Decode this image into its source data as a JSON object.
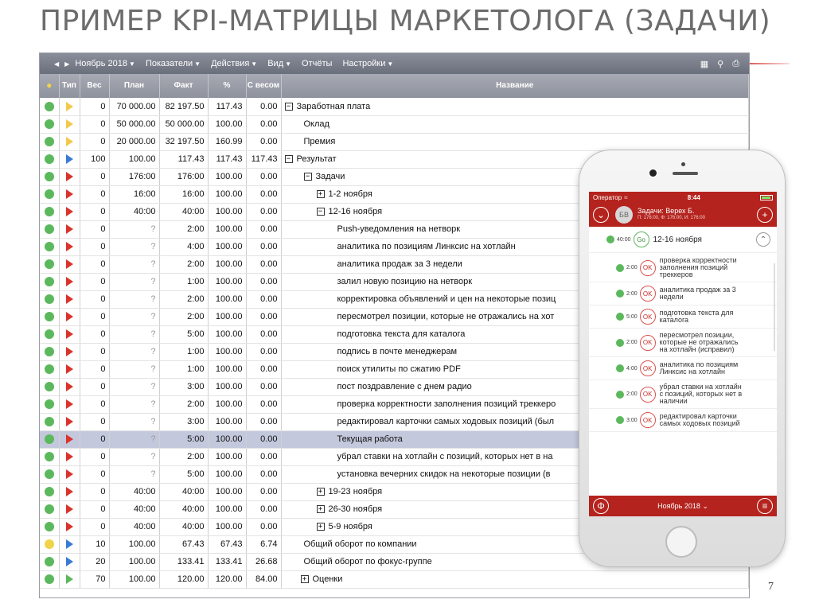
{
  "slide": {
    "title": "ПРИМЕР KPI-МАТРИЦЫ МАРКЕТОЛОГА (ЗАДАЧИ)",
    "page_number": "7"
  },
  "toolbar": {
    "prev_icon": "caret-left-icon",
    "next_icon": "caret-right-icon",
    "menus": [
      "Ноябрь 2018",
      "Показатели",
      "Действия",
      "Вид",
      "Отчёты",
      "Настройки"
    ],
    "right_icons": [
      "grid-icon",
      "search-icon",
      "print-icon"
    ]
  },
  "colors": {
    "status_green": "#5cb85c",
    "status_yellow": "#f0d34a",
    "flag_yellow": "#f2c94c",
    "flag_blue": "#3a7bd5",
    "flag_red": "#d9342b",
    "flag_green": "#5cb85c",
    "accent_red": "#b4231d"
  },
  "table": {
    "headers": [
      "",
      "Тип",
      "Вес",
      "План",
      "Факт",
      "%",
      "С весом",
      "Название"
    ],
    "rows": [
      {
        "status": "green",
        "flag": "yellow",
        "ves": "0",
        "plan": "70 000.00",
        "fact": "82 197.50",
        "pct": "117.43",
        "weighted": "0.00",
        "level": 0,
        "toggle": "−",
        "name": "Заработная плата"
      },
      {
        "status": "green",
        "flag": "yellow",
        "ves": "0",
        "plan": "50 000.00",
        "fact": "50 000.00",
        "pct": "100.00",
        "weighted": "0.00",
        "level": 1,
        "toggle": "",
        "name": "Оклад"
      },
      {
        "status": "green",
        "flag": "yellow",
        "ves": "0",
        "plan": "20 000.00",
        "fact": "32 197.50",
        "pct": "160.99",
        "weighted": "0.00",
        "level": 1,
        "toggle": "",
        "name": "Премия"
      },
      {
        "status": "green",
        "flag": "blue",
        "ves": "100",
        "plan": "100.00",
        "fact": "117.43",
        "pct": "117.43",
        "weighted": "117.43",
        "level": 0,
        "toggle": "−",
        "name": "Результат"
      },
      {
        "status": "green",
        "flag": "red",
        "ves": "0",
        "plan": "176:00",
        "fact": "176:00",
        "pct": "100.00",
        "weighted": "0.00",
        "level": 1,
        "toggle": "−",
        "name": "Задачи"
      },
      {
        "status": "green",
        "flag": "red",
        "ves": "0",
        "plan": "16:00",
        "fact": "16:00",
        "pct": "100.00",
        "weighted": "0.00",
        "level": 2,
        "toggle": "+",
        "name": "1-2 ноября"
      },
      {
        "status": "green",
        "flag": "red",
        "ves": "0",
        "plan": "40:00",
        "fact": "40:00",
        "pct": "100.00",
        "weighted": "0.00",
        "level": 2,
        "toggle": "−",
        "name": "12-16 ноября"
      },
      {
        "status": "green",
        "flag": "red",
        "ves": "0",
        "plan": "?",
        "fact": "2:00",
        "pct": "100.00",
        "weighted": "0.00",
        "level": 3,
        "toggle": "",
        "name": "Push-уведомления на нетворк"
      },
      {
        "status": "green",
        "flag": "red",
        "ves": "0",
        "plan": "?",
        "fact": "4:00",
        "pct": "100.00",
        "weighted": "0.00",
        "level": 3,
        "toggle": "",
        "name": "аналитика по позициям Линксис на хотлайн"
      },
      {
        "status": "green",
        "flag": "red",
        "ves": "0",
        "plan": "?",
        "fact": "2:00",
        "pct": "100.00",
        "weighted": "0.00",
        "level": 3,
        "toggle": "",
        "name": "аналитика продаж за 3 недели"
      },
      {
        "status": "green",
        "flag": "red",
        "ves": "0",
        "plan": "?",
        "fact": "1:00",
        "pct": "100.00",
        "weighted": "0.00",
        "level": 3,
        "toggle": "",
        "name": "залил новую позицию на нетворк"
      },
      {
        "status": "green",
        "flag": "red",
        "ves": "0",
        "plan": "?",
        "fact": "2:00",
        "pct": "100.00",
        "weighted": "0.00",
        "level": 3,
        "toggle": "",
        "name": "корректировка объявлений и цен на некоторые позиц"
      },
      {
        "status": "green",
        "flag": "red",
        "ves": "0",
        "plan": "?",
        "fact": "2:00",
        "pct": "100.00",
        "weighted": "0.00",
        "level": 3,
        "toggle": "",
        "name": "пересмотрел позиции, которые не отражались на хот"
      },
      {
        "status": "green",
        "flag": "red",
        "ves": "0",
        "plan": "?",
        "fact": "5:00",
        "pct": "100.00",
        "weighted": "0.00",
        "level": 3,
        "toggle": "",
        "name": "подготовка текста для каталога"
      },
      {
        "status": "green",
        "flag": "red",
        "ves": "0",
        "plan": "?",
        "fact": "1:00",
        "pct": "100.00",
        "weighted": "0.00",
        "level": 3,
        "toggle": "",
        "name": "подпись в почте менеджерам"
      },
      {
        "status": "green",
        "flag": "red",
        "ves": "0",
        "plan": "?",
        "fact": "1:00",
        "pct": "100.00",
        "weighted": "0.00",
        "level": 3,
        "toggle": "",
        "name": "поиск утилиты по сжатию PDF"
      },
      {
        "status": "green",
        "flag": "red",
        "ves": "0",
        "plan": "?",
        "fact": "3:00",
        "pct": "100.00",
        "weighted": "0.00",
        "level": 3,
        "toggle": "",
        "name": "пост поздравление с днем радио"
      },
      {
        "status": "green",
        "flag": "red",
        "ves": "0",
        "plan": "?",
        "fact": "2:00",
        "pct": "100.00",
        "weighted": "0.00",
        "level": 3,
        "toggle": "",
        "name": "проверка корректности заполнения позиций треккеро"
      },
      {
        "status": "green",
        "flag": "red",
        "ves": "0",
        "plan": "?",
        "fact": "3:00",
        "pct": "100.00",
        "weighted": "0.00",
        "level": 3,
        "toggle": "",
        "name": "редактировал карточки самых ходовых позиций (был"
      },
      {
        "status": "green",
        "flag": "red",
        "ves": "0",
        "plan": "?",
        "fact": "5:00",
        "pct": "100.00",
        "weighted": "0.00",
        "level": 3,
        "toggle": "",
        "name": "Текущая работа",
        "selected": true
      },
      {
        "status": "green",
        "flag": "red",
        "ves": "0",
        "plan": "?",
        "fact": "2:00",
        "pct": "100.00",
        "weighted": "0.00",
        "level": 3,
        "toggle": "",
        "name": "убрал ставки на хотлайн с позиций, которых нет в на"
      },
      {
        "status": "green",
        "flag": "red",
        "ves": "0",
        "plan": "?",
        "fact": "5:00",
        "pct": "100.00",
        "weighted": "0.00",
        "level": 3,
        "toggle": "",
        "name": "установка вечерних скидок на некоторые позиции (в"
      },
      {
        "status": "green",
        "flag": "red",
        "ves": "0",
        "plan": "40:00",
        "fact": "40:00",
        "pct": "100.00",
        "weighted": "0.00",
        "level": 2,
        "toggle": "+",
        "name": "19-23 ноября"
      },
      {
        "status": "green",
        "flag": "red",
        "ves": "0",
        "plan": "40:00",
        "fact": "40:00",
        "pct": "100.00",
        "weighted": "0.00",
        "level": 2,
        "toggle": "+",
        "name": "26-30 ноября"
      },
      {
        "status": "green",
        "flag": "red",
        "ves": "0",
        "plan": "40:00",
        "fact": "40:00",
        "pct": "100.00",
        "weighted": "0.00",
        "level": 2,
        "toggle": "+",
        "name": "5-9 ноября"
      },
      {
        "status": "yellow",
        "flag": "blue",
        "ves": "10",
        "plan": "100.00",
        "fact": "67.43",
        "pct": "67.43",
        "weighted": "6.74",
        "level": 1,
        "toggle": "",
        "name": "Общий оборот по компании"
      },
      {
        "status": "green",
        "flag": "blue",
        "ves": "20",
        "plan": "100.00",
        "fact": "133.41",
        "pct": "133.41",
        "weighted": "26.68",
        "level": 1,
        "toggle": "",
        "name": "Общий оборот по фокус-группе"
      },
      {
        "status": "green",
        "flag": "green",
        "ves": "70",
        "plan": "100.00",
        "fact": "120.00",
        "pct": "120.00",
        "weighted": "84.00",
        "level": 0,
        "toggle": "+",
        "name": "Оценки",
        "indent_extra": true
      }
    ]
  },
  "phone": {
    "carrier": "Оператор",
    "time": "8:44",
    "header_title": "Задачи: Верех Б.",
    "header_sub": "П: 176:00, Ф: 176:00, И: 176:00",
    "avatar_initials": "БВ",
    "group": {
      "time": "40:00",
      "badge": "Go",
      "name": "12-16 ноября"
    },
    "tasks": [
      {
        "time": "2:00",
        "badge": "OK",
        "name": "проверка корректности заполнения позиций треккеров"
      },
      {
        "time": "2:00",
        "badge": "OK",
        "name": "аналитика продаж за 3  недели"
      },
      {
        "time": "5:00",
        "badge": "OK",
        "name": "подготовка текста для каталога"
      },
      {
        "time": "2:00",
        "badge": "OK",
        "name": "пересмотрел позиции, которые не отражались на хотлайн (исправил)"
      },
      {
        "time": "4:00",
        "badge": "OK",
        "name": "аналитика по позициям Линксис на хотлайн"
      },
      {
        "time": "2:00",
        "badge": "OK",
        "name": "убрал ставки на хотлайн с позиций, которых нет в наличии"
      },
      {
        "time": "3:00",
        "badge": "OK",
        "name": "редактировал карточки самых ходовых позиций"
      }
    ],
    "bottom_month": "Ноябрь 2018"
  }
}
